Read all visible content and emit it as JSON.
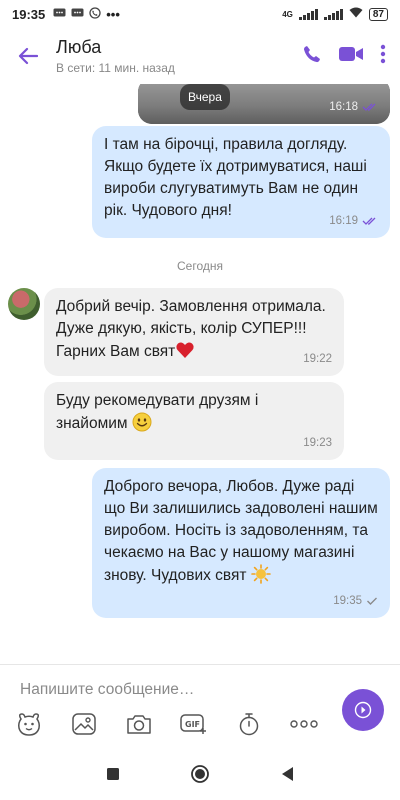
{
  "status": {
    "time": "19:35",
    "network": "4G",
    "battery": "87"
  },
  "header": {
    "name": "Люба",
    "last_seen": "В сети: 11 мин. назад"
  },
  "messages": [
    {
      "kind": "image",
      "date_chip": "Вчера",
      "time": "16:18"
    },
    {
      "kind": "outgoing",
      "text": "І там на бірочці, правила догляду. Якщо будете їх дотримуватися, наші вироби слугуватимуть Вам не один рік. Чудового дня!",
      "time": "16:19"
    },
    {
      "kind": "separator",
      "text": "Сегодня"
    },
    {
      "kind": "incoming",
      "text": "Добрий вечір. Замовлення отримала. Дуже дякую, якість, колір СУПЕР!!! Гарних Вам свят",
      "time": "19:22"
    },
    {
      "kind": "incoming",
      "text": "Буду рекомедувати друзям і знайомим",
      "time": "19:23"
    },
    {
      "kind": "outgoing",
      "text": "Доброго вечора, Любов. Дуже раді що Ви залишились задоволені нашим виробом. Носіть із задоволенням, та чекаємо на Вас у нашому магазині знову. Чудових свят",
      "time": "19:35"
    }
  ],
  "composer": {
    "placeholder": "Напишите сообщение…",
    "tools": [
      "sticker-icon",
      "gallery-icon",
      "camera-icon",
      "gif-icon",
      "timer-icon",
      "more-icon"
    ]
  },
  "colors": {
    "accent": "#7a51d6",
    "outgoing_bubble": "#d6e9ff",
    "incoming_bubble": "#f0f0f0",
    "read_ticks": "#7a51d6"
  }
}
